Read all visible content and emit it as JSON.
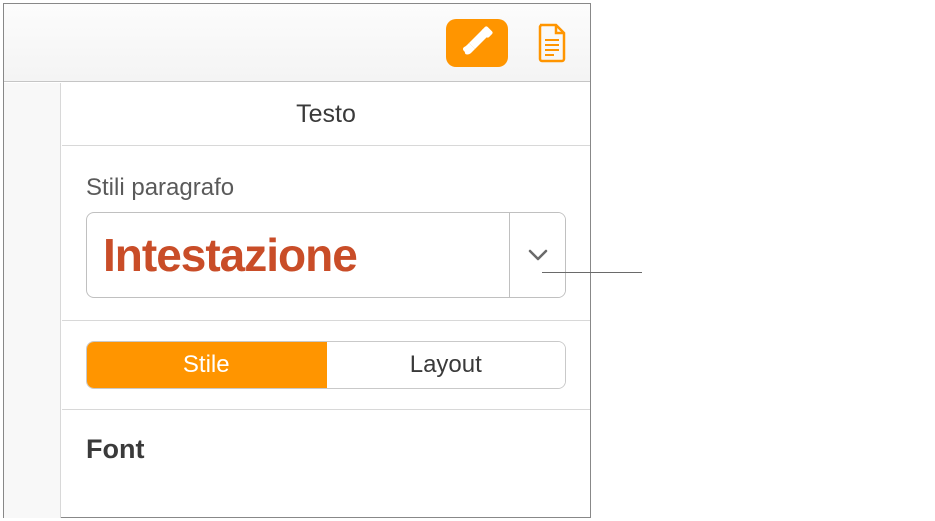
{
  "header": {
    "text_label": "Testo"
  },
  "paragraph_styles": {
    "label": "Stili paragrafo",
    "selected": "Intestazione"
  },
  "tabs": {
    "style": "Stile",
    "layout": "Layout"
  },
  "font": {
    "label": "Font"
  }
}
